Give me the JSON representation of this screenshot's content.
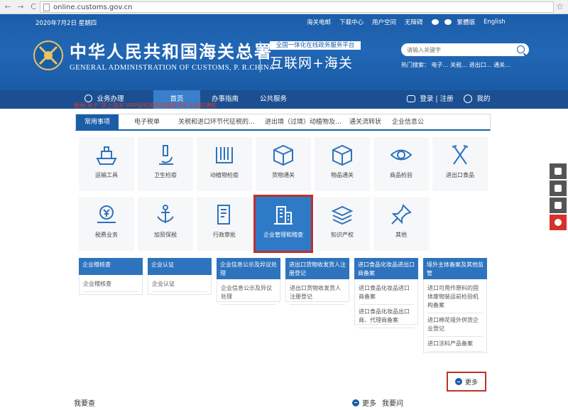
{
  "browser": {
    "url": "online.customs.gov.cn",
    "back": "←",
    "forward": "→",
    "reload": "C",
    "star": "☆"
  },
  "header": {
    "date": "2020年7月2日  星期四",
    "top_links": [
      "海关电邮",
      "下载中心",
      "用户空间",
      "无障碍",
      "繁體版",
      "English"
    ],
    "title_cn": "中华人民共和国海关总署",
    "title_en": "GENERAL ADMINISTRATION OF CUSTOMS, P. R.CHINA",
    "platform_tag": "全国一体化在线政务服务平台",
    "platform_title": "互联网+海关",
    "search_placeholder": "请输入关键字",
    "hot_search": "热门搜索：  电子…  关税…  进出口…  通关…"
  },
  "nav": {
    "menu": "业务办理",
    "items": [
      "首页",
      "办事指南",
      "公共服务"
    ],
    "login": "登录  |  注册",
    "mine": "我的"
  },
  "notice": "要闻:关于\"掌上海关\"APP深圳关特色服务专区上线的通知",
  "tabs": [
    "常用事项",
    "电子税单",
    "关税和进口环节代征税的…",
    "进出境（过境）动植物及…",
    "通关流转状",
    "企业信息公"
  ],
  "tiles_row1": [
    "运输工具",
    "卫生检疫",
    "动植物检疫",
    "货物通关",
    "物品通关",
    "商品检验",
    "进出口食品"
  ],
  "tiles_row2": [
    "税费业务",
    "加贸保税",
    "行政审批",
    "企业管理和稽查",
    "知识产权",
    "其他"
  ],
  "subcats": [
    {
      "head": "企业稽核查",
      "items": [
        "企业稽核查"
      ]
    },
    {
      "head": "企业认证",
      "items": [
        "企业认证"
      ]
    },
    {
      "head": "企业信息公示及异议处理",
      "items": [
        "企业信息公示及异议处理"
      ]
    },
    {
      "head": "进出口货物收发货人注册登记",
      "items": [
        "进出口货物收发货人注册登记"
      ]
    },
    {
      "head": "进口食品化妆品进出口商备案",
      "items": [
        "进口食品化妆品进口商备案",
        "进口食品化妆品出口商、代理商备案"
      ]
    },
    {
      "head": "境外主体备案及其他监管",
      "items": [
        "进口可用作原料的固体废物装运前检验机构备案",
        "进口棉花境外供货企业登记",
        "进口涂料产品备案"
      ]
    }
  ],
  "more": "更多",
  "bottom": {
    "left": "我要查",
    "more": "更多",
    "right": "我要问"
  }
}
